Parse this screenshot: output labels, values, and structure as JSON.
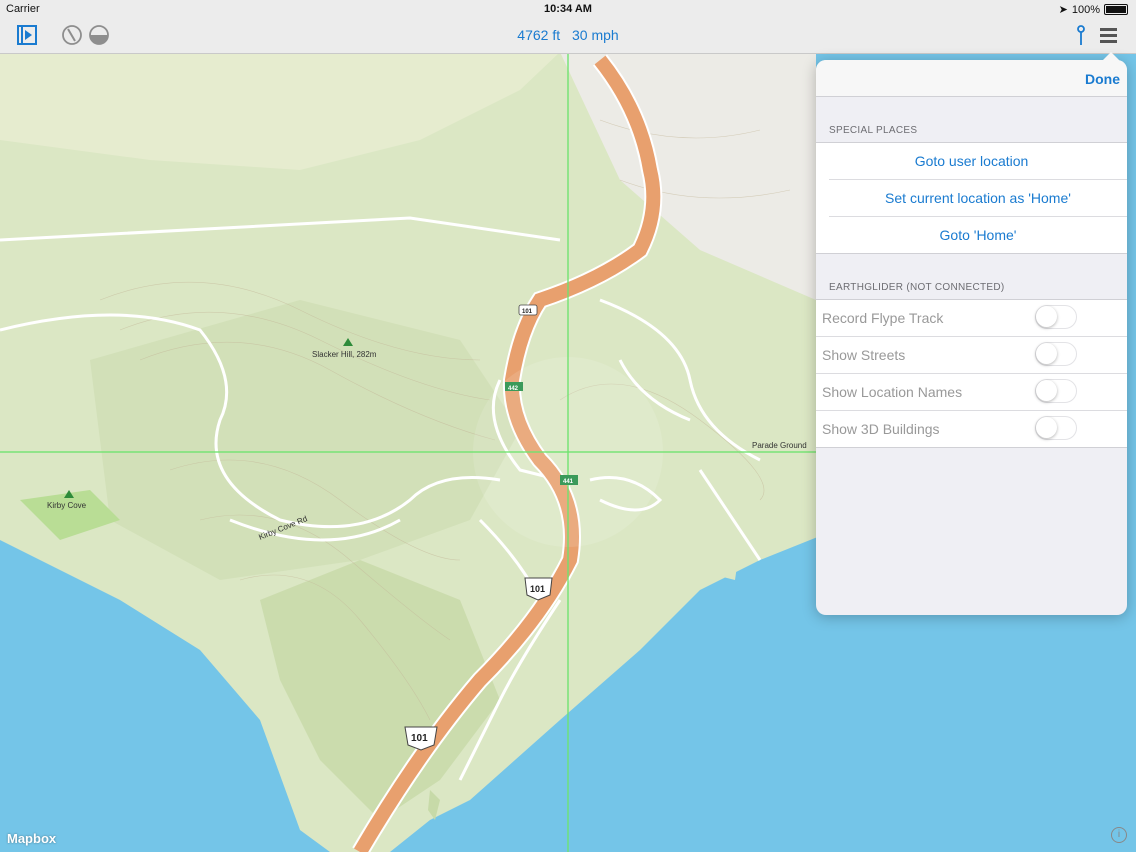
{
  "status": {
    "carrier": "Carrier",
    "time": "10:34 AM",
    "battery": "100%"
  },
  "toolbar": {
    "altitude": "4762 ft",
    "speed": "30 mph"
  },
  "popover": {
    "done_label": "Done",
    "special_places": {
      "title": "SPECIAL PLACES",
      "items": [
        "Goto user location",
        "Set current location as 'Home'",
        "Goto 'Home'"
      ]
    },
    "earthglider": {
      "title": "EARTHGLIDER (NOT CONNECTED)",
      "toggles": [
        {
          "label": "Record Flype Track",
          "on": false
        },
        {
          "label": "Show Streets",
          "on": false
        },
        {
          "label": "Show Location Names",
          "on": false
        },
        {
          "label": "Show 3D Buildings",
          "on": false
        }
      ]
    }
  },
  "map": {
    "labels": {
      "slacker_hill": "Slacker Hill, 282m",
      "kirby_cove": "Kirby Cove",
      "parade_ground": "Parade Ground",
      "kirby_cove_rd": "Kirby Cove Rd"
    },
    "shields": [
      "101",
      "442",
      "441",
      "101",
      "101"
    ],
    "attribution": "Mapbox",
    "info": "i"
  },
  "colors": {
    "accent": "#1a7bd0",
    "water": "#74c5e8",
    "land": "#dfe9c8",
    "highway": "#e8a06e"
  }
}
